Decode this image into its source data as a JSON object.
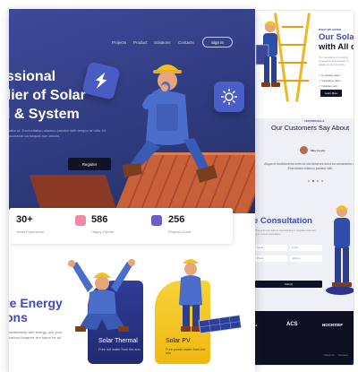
{
  "nav": {
    "links": [
      "Projects",
      "Product",
      "Solutions",
      "Contacts"
    ],
    "signin": "Sign In"
  },
  "hero": {
    "title_lines": [
      "essional",
      "plier of Solar",
      "el & System"
    ],
    "desc": "tatur ut. Excercitation ullamco pariatur with tempor at odio. Et occaecat consequat non laboris.",
    "register": "Register"
  },
  "stats": [
    {
      "num": "30+",
      "label": "Years Experience",
      "color": "#2b3590"
    },
    {
      "num": "586",
      "label": "Happy Clients",
      "color": "#f08aa6"
    },
    {
      "num": "256",
      "label": "Projects Done",
      "color": "#6a5fc9"
    }
  ],
  "energy": {
    "title_lines": [
      "te Energy",
      "ons"
    ],
    "desc": "relationship with energy. uce your carbon footprint. ent future for all."
  },
  "cards": [
    {
      "title": "Solar Thermal",
      "sub": "Free hot water from the sun"
    },
    {
      "title": "Solar PV",
      "sub": "Free power water from the sun"
    }
  ],
  "right": {
    "eyebrow": "WHAT WE OFFER",
    "title_lines": [
      "Our Solar",
      "with All of"
    ],
    "desc": "Our commitment to energy engaged in and services ut aliquip ex ea commodo.",
    "checks": [
      "Ut pariatur quam",
      "Voluptatem ullam",
      "Voluptate velit"
    ],
    "button": "Learn More",
    "testimonial_eyebrow": "TESTIMONIALS",
    "testimonial_title": "Our Customers Say About",
    "customer_name": "Mike Hendly",
    "quote": "Aliqua et incididunt ea enim do nisi deserunt dolor ea consectetur ut. Exercitation ullamco pariatur with",
    "consult_title": "e Consultation",
    "consult_desc": "Duis aute irure dolor in reprehenderit in voluptate velit esse, quis nostrud exercitation.",
    "field_labels": [
      "Name",
      "Email",
      "Phone",
      "Address"
    ],
    "consult_button": "Submit",
    "footer_logos": [
      "ACS",
      "HOCHTIEF"
    ],
    "footer_links": [
      "About Us",
      "Services"
    ]
  },
  "colors": {
    "hero": "#343f88",
    "accent": "#3d4bb8",
    "dark": "#101322",
    "card_blue": "#2b3590",
    "card_yellow": "#f3c21a"
  }
}
